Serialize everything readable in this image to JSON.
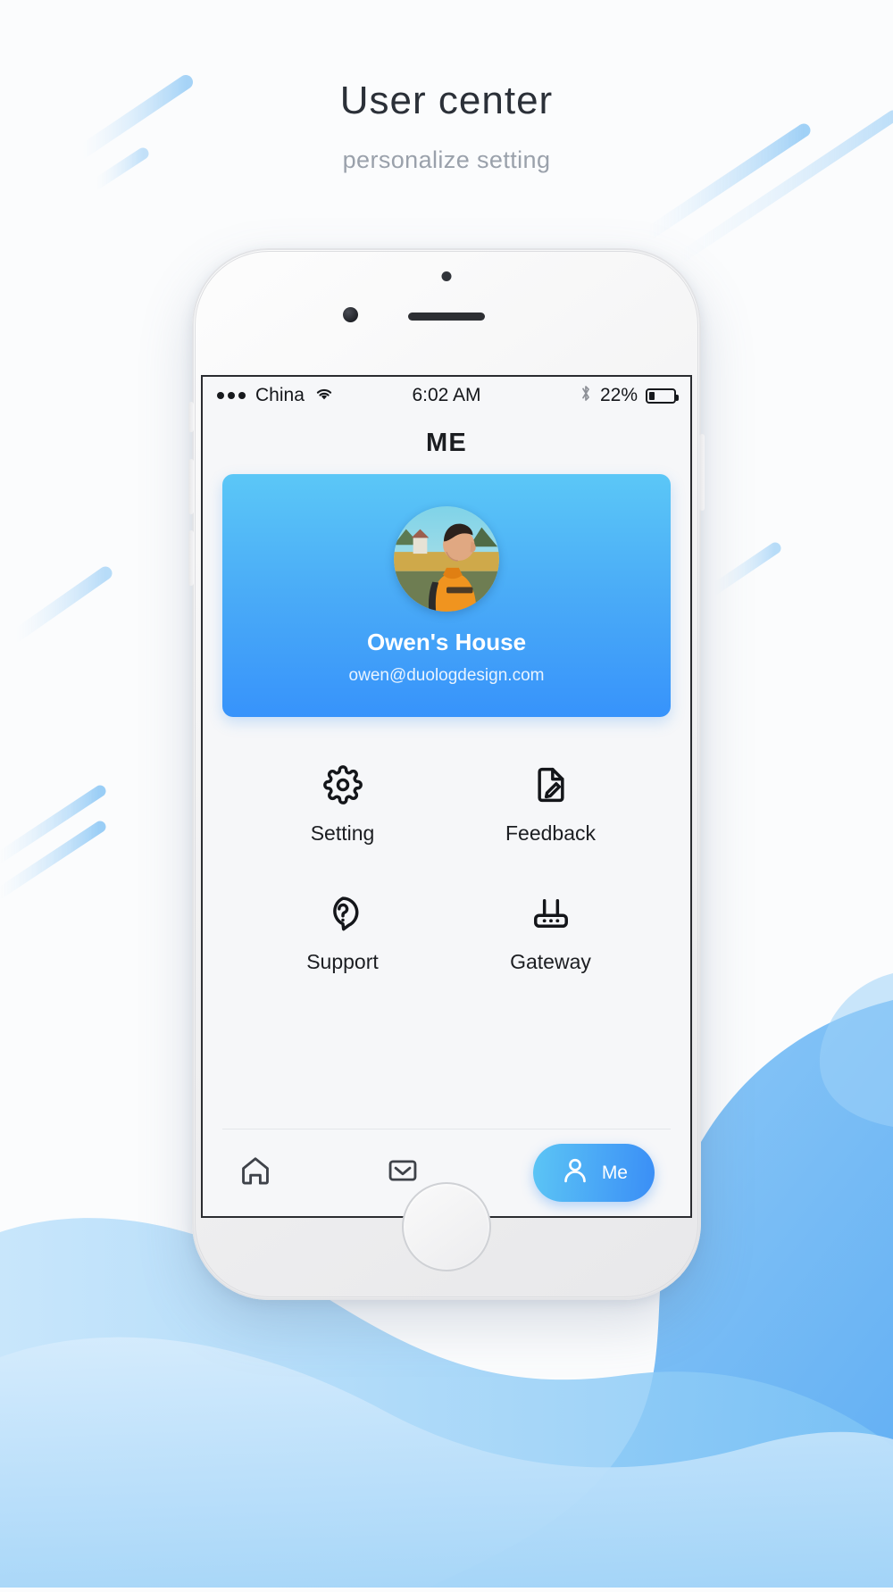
{
  "page": {
    "title": "User center",
    "subtitle": "personalize setting"
  },
  "colors": {
    "accent_light": "#5BC7F7",
    "accent_dark": "#3793FB",
    "page_bg": "#FBFCFD",
    "screen_bg": "#F6F7F9",
    "text_primary": "#1C1E22",
    "text_muted": "#9AA1AB"
  },
  "statusbar": {
    "dots_icon": "signal-dots-icon",
    "carrier": "China",
    "wifi_icon": "wifi-icon",
    "time": "6:02 AM",
    "bluetooth_icon": "bluetooth-icon",
    "battery_percent": "22%",
    "battery_level": 22,
    "battery_icon": "battery-icon"
  },
  "nav": {
    "title": "ME"
  },
  "profile": {
    "avatar_icon": "user-avatar-photo",
    "name": "Owen's House",
    "email": "owen@duologdesign.com"
  },
  "menu": {
    "items": [
      {
        "label": "Setting",
        "icon": "gear-icon"
      },
      {
        "label": "Feedback",
        "icon": "document-pencil-icon"
      },
      {
        "label": "Support",
        "icon": "question-bubble-icon"
      },
      {
        "label": "Gateway",
        "icon": "router-icon"
      }
    ]
  },
  "tabbar": {
    "items": [
      {
        "label": "Home",
        "icon": "home-icon",
        "active": false
      },
      {
        "label": "Message",
        "icon": "envelope-icon",
        "active": false
      },
      {
        "label": "Me",
        "icon": "person-icon",
        "active": true
      }
    ],
    "active_label": "Me"
  }
}
